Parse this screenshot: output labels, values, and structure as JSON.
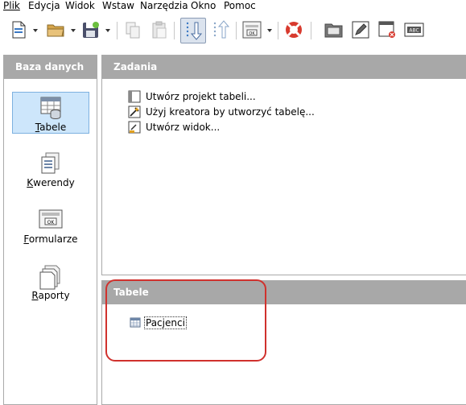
{
  "menubar": {
    "items": [
      {
        "label": "Plik"
      },
      {
        "label": "Edycja"
      },
      {
        "label": "Widok"
      },
      {
        "label": "Wstaw"
      },
      {
        "label": "Narzędzia"
      },
      {
        "label": "Okno"
      },
      {
        "label": "Pomoc"
      }
    ]
  },
  "toolbar": {
    "buttons": [
      {
        "icon": "new-document-icon"
      },
      {
        "icon": "open-folder-icon"
      },
      {
        "icon": "save-icon"
      },
      {
        "icon": "copy-icon"
      },
      {
        "icon": "paste-icon"
      },
      {
        "icon": "sort-descending-icon"
      },
      {
        "icon": "sort-ascending-icon"
      },
      {
        "icon": "form-design-icon"
      },
      {
        "icon": "help-lifebuoy-icon"
      },
      {
        "icon": "open-database-object-icon"
      },
      {
        "icon": "edit-icon"
      },
      {
        "icon": "delete-icon"
      },
      {
        "icon": "rename-icon"
      }
    ]
  },
  "left_panel": {
    "title": "Baza danych",
    "items": [
      {
        "label": "Tabele",
        "mnemonic": "T",
        "rest": "abele",
        "selected": true,
        "icon": "tables-icon"
      },
      {
        "label": "Kwerendy",
        "mnemonic": "K",
        "rest": "werendy",
        "icon": "queries-icon"
      },
      {
        "label": "Formularze",
        "mnemonic": "F",
        "rest": "ormularze",
        "icon": "forms-icon"
      },
      {
        "label": "Raporty",
        "mnemonic": "R",
        "rest": "aporty",
        "icon": "reports-icon"
      }
    ]
  },
  "tasks_panel": {
    "title": "Zadania",
    "tasks": [
      {
        "label": "Utwórz projekt tabeli...",
        "icon": "table-design-icon"
      },
      {
        "label": "Użyj kreatora by utworzyć tabelę...",
        "icon": "wizard-icon"
      },
      {
        "label": "Utwórz widok...",
        "icon": "view-icon"
      }
    ]
  },
  "tables_panel": {
    "title": "Tabele",
    "tables": [
      {
        "label": "Pacjenci",
        "icon": "table-icon"
      }
    ]
  },
  "colors": {
    "panel_header": "#a8a8a8",
    "selection_bg": "#cde6fb",
    "highlight": "#d0312d"
  }
}
